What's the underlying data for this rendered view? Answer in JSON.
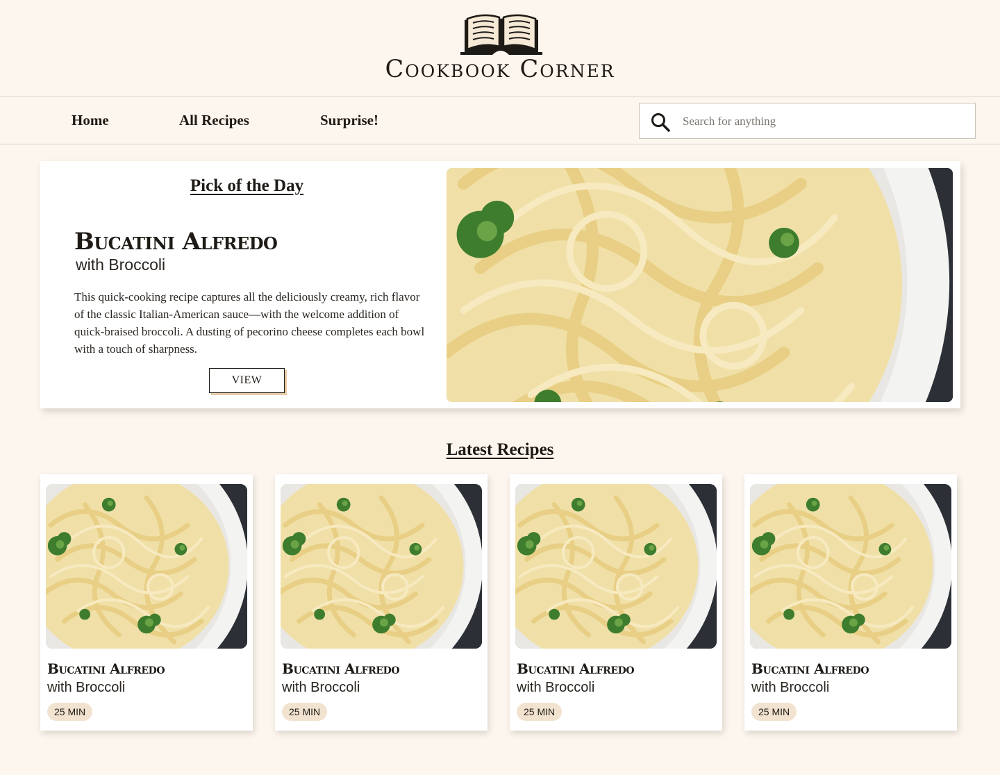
{
  "site": {
    "title": "Cookbook Corner",
    "logo_icon": "open-book-icon"
  },
  "nav": {
    "items": [
      {
        "label": "Home"
      },
      {
        "label": "All Recipes"
      },
      {
        "label": "Surprise!"
      }
    ],
    "search": {
      "placeholder": "Search for anything",
      "value": "",
      "icon": "search-icon"
    }
  },
  "pick_of_the_day": {
    "heading": "Pick of the Day",
    "title": "Bucatini Alfredo",
    "subtitle": "with Broccoli",
    "description": "This quick-cooking recipe captures all the deliciously creamy, rich flavor of the classic Italian-American sauce—with the welcome addition of quick-braised broccoli. A dusting of pecorino cheese completes each bowl with a touch of sharpness.",
    "button_label": "VIEW"
  },
  "latest": {
    "heading": "Latest Recipes",
    "recipes": [
      {
        "title": "Bucatini Alfredo",
        "subtitle": "with Broccoli",
        "time": "25 MIN"
      },
      {
        "title": "Bucatini Alfredo",
        "subtitle": "with Broccoli",
        "time": "25 MIN"
      },
      {
        "title": "Bucatini Alfredo",
        "subtitle": "with Broccoli",
        "time": "25 MIN"
      },
      {
        "title": "Bucatini Alfredo",
        "subtitle": "with Broccoli",
        "time": "25 MIN"
      }
    ]
  },
  "colors": {
    "background": "#fdf6ee",
    "text": "#1e1a16",
    "badge": "#f2e3d0",
    "button_shadow": "#e8caa6"
  }
}
